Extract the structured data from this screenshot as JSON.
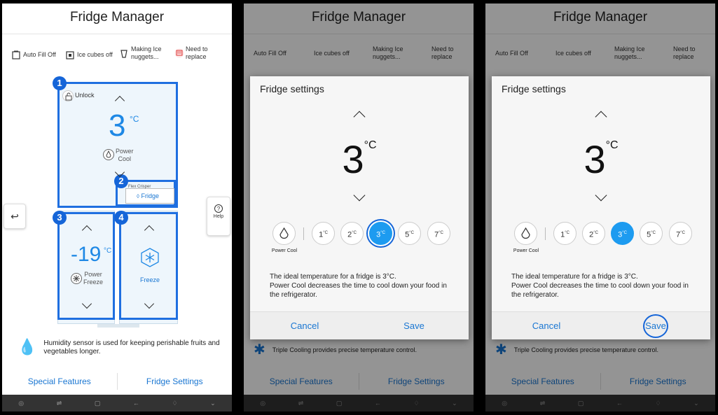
{
  "app_title": "Fridge Manager",
  "status": {
    "auto_fill": "Auto Fill Off",
    "ice_cubes": "Ice cubes off",
    "making_ice_1": "Making Ice",
    "making_ice_2": "nuggets...",
    "need_replace_1": "Need to",
    "need_replace_2": "replace"
  },
  "diagram": {
    "unlock": "Unlock",
    "fridge_temp": "3",
    "fridge_unit": "°C",
    "power_cool_1": "Power",
    "power_cool_2": "Cool",
    "flex_crisper": "Flex Crisper",
    "flex_mode": "Fridge",
    "freezer_temp": "-19",
    "freezer_unit": "°C",
    "power_freeze_1": "Power",
    "power_freeze_2": "Freeze",
    "right_mode": "Freeze",
    "markers": [
      "1",
      "2",
      "3",
      "4"
    ]
  },
  "help_label": "Help",
  "humidity_text": "Humidity sensor is used for keeping perishable fruits and vegetables longer.",
  "triple_text": "Triple Cooling provides precise temperature control.",
  "tabs": {
    "special": "Special Features",
    "settings": "Fridge Settings"
  },
  "dialog": {
    "title": "Fridge settings",
    "temp": "3",
    "unit": "°C",
    "power_cool": "Power Cool",
    "options": [
      "1",
      "2",
      "3",
      "5",
      "7"
    ],
    "option_unit": "°C",
    "selected": "3",
    "desc_1": "The ideal temperature for a fridge is 3°C.",
    "desc_2": "Power Cool decreases the time to cool down your food in the refrigerator.",
    "cancel": "Cancel",
    "save": "Save"
  },
  "colors": {
    "accent": "#1976d2",
    "highlight": "#1f6fe0",
    "selected": "#1d9bf0"
  }
}
